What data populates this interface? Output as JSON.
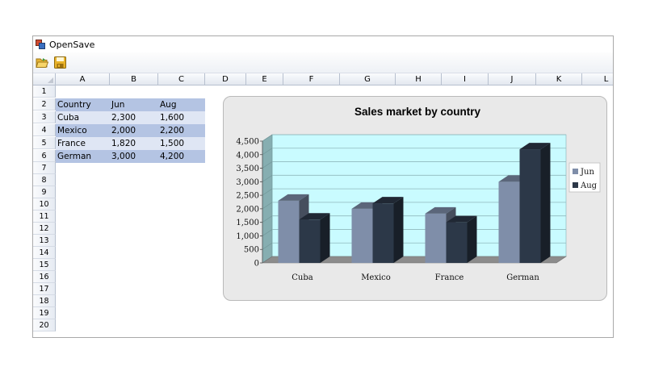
{
  "window": {
    "title": "OpenSave"
  },
  "toolbar": {
    "open_icon": "folder-open-icon",
    "save_icon": "floppy-disk-icon"
  },
  "grid": {
    "columns": [
      "A",
      "B",
      "C",
      "D",
      "E",
      "F",
      "G",
      "H",
      "I",
      "J",
      "K",
      "L"
    ],
    "rows": [
      "1",
      "2",
      "3",
      "4",
      "5",
      "6",
      "7",
      "8",
      "9",
      "10",
      "11",
      "12",
      "13",
      "14",
      "15",
      "16",
      "17",
      "18",
      "19",
      "20"
    ],
    "header_row": [
      "Country",
      "Jun",
      "Aug"
    ],
    "data_rows": [
      [
        "Cuba",
        "2,300",
        "1,600"
      ],
      [
        "Mexico",
        "2,000",
        "2,200"
      ],
      [
        "France",
        "1,820",
        "1,500"
      ],
      [
        "German",
        "3,000",
        "4,200"
      ]
    ],
    "band_colors": {
      "dark": "#b4c4e3",
      "light": "#dfe6f4"
    }
  },
  "chart_data": {
    "type": "bar",
    "title": "Sales market by country",
    "categories": [
      "Cuba",
      "Mexico",
      "France",
      "German"
    ],
    "series": [
      {
        "name": "Jun",
        "values": [
          2300,
          2000,
          1820,
          3000
        ],
        "color": "#7f8ea9"
      },
      {
        "name": "Aug",
        "values": [
          1600,
          2200,
          1500,
          4200
        ],
        "color": "#2c3848"
      }
    ],
    "ylim": [
      0,
      4500
    ],
    "yticks": [
      "0",
      "500",
      "1,000",
      "1,500",
      "2,000",
      "2,500",
      "3,000",
      "3,500",
      "4,000",
      "4,500"
    ],
    "legend": "right",
    "plot_background": "#c9fbff",
    "grid": true
  }
}
